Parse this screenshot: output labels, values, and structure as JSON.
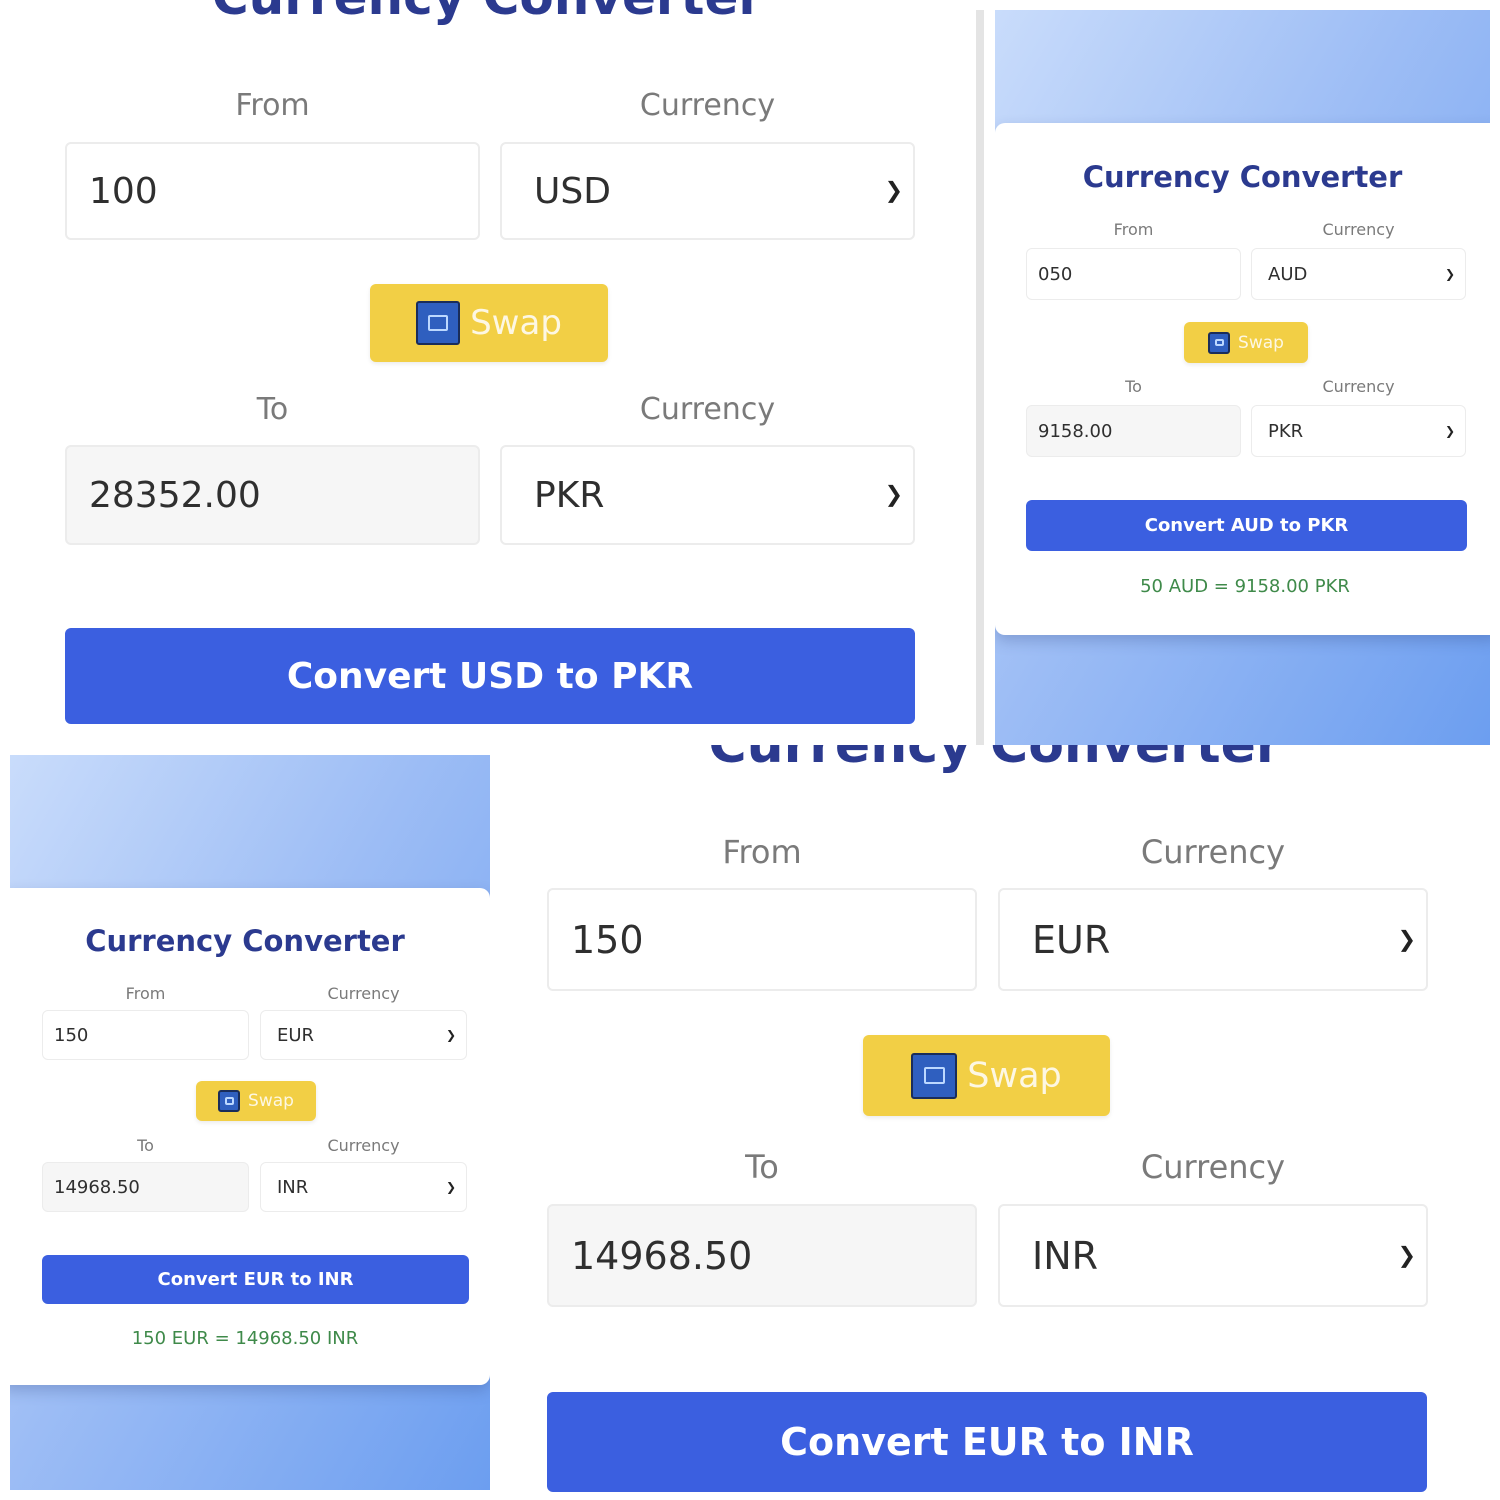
{
  "panel1": {
    "title": "Currency Converter",
    "from_label": "From",
    "currency_label_1": "Currency",
    "amount": "100",
    "from_currency": "USD",
    "swap_label": "Swap",
    "to_label": "To",
    "currency_label_2": "Currency",
    "converted_amount": "28352.00",
    "to_currency": "PKR",
    "convert_button": "Convert USD to PKR"
  },
  "panel2": {
    "title": "Currency Converter",
    "from_label": "From",
    "currency_label_1": "Currency",
    "amount": "050",
    "from_currency": "AUD",
    "swap_label": "Swap",
    "to_label": "To",
    "currency_label_2": "Currency",
    "converted_amount": "9158.00",
    "to_currency": "PKR",
    "convert_button": "Convert AUD to PKR",
    "result": "50 AUD = 9158.00 PKR"
  },
  "panel3": {
    "title": "Currency Converter",
    "from_label": "From",
    "currency_label_1": "Currency",
    "amount": "150",
    "from_currency": "EUR",
    "swap_label": "Swap",
    "to_label": "To",
    "currency_label_2": "Currency",
    "converted_amount": "14968.50",
    "to_currency": "INR",
    "convert_button": "Convert EUR to INR",
    "result": "150 EUR = 14968.50 INR"
  },
  "panel4": {
    "title": "Currency Converter",
    "from_label": "From",
    "currency_label_1": "Currency",
    "amount": "150",
    "from_currency": "EUR",
    "swap_label": "Swap",
    "to_label": "To",
    "currency_label_2": "Currency",
    "converted_amount": "14968.50",
    "to_currency": "INR",
    "convert_button": "Convert EUR to INR"
  },
  "icons": {
    "chevron": "chevron-down-icon",
    "swap": "swap-icon"
  },
  "colors": {
    "title": "#2b3a8f",
    "convert_button": "#3b5fe0",
    "swap_button": "#f2cf45",
    "result_text": "#3f8a4a",
    "background_gradient_end": "#6c9ef0"
  }
}
